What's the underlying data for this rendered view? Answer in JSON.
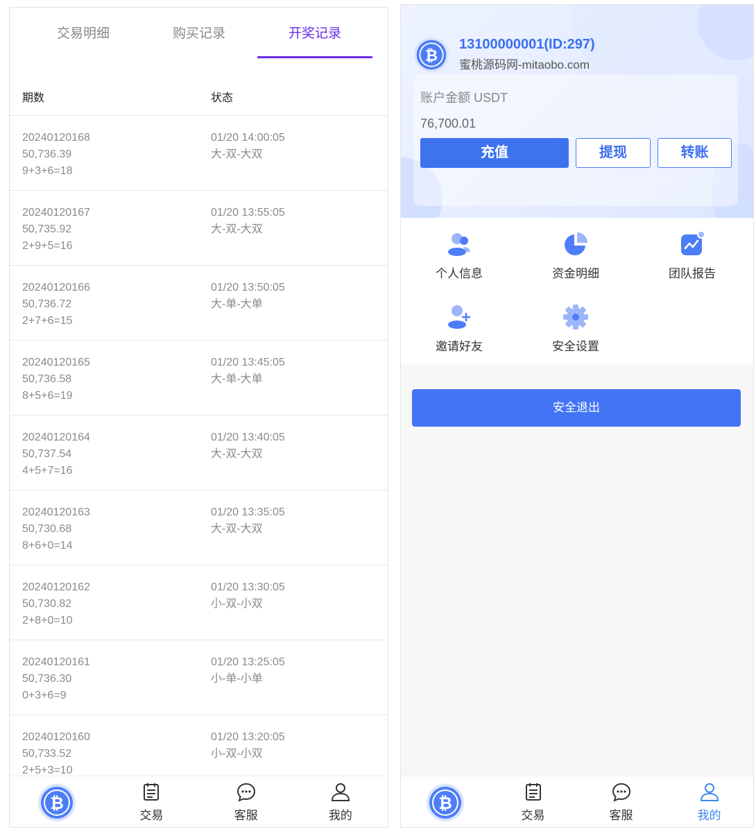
{
  "left": {
    "tabs": [
      {
        "label": "交易明细",
        "active": false
      },
      {
        "label": "购买记录",
        "active": false
      },
      {
        "label": "开奖记录",
        "active": true
      }
    ],
    "table_headers": {
      "period": "期数",
      "status": "状态"
    },
    "rows": [
      {
        "period": "20240120168",
        "price": "50,736.39",
        "formula": "9+3+6=18",
        "time": "01/20 14:00:05",
        "result": "大-双-大双"
      },
      {
        "period": "20240120167",
        "price": "50,735.92",
        "formula": "2+9+5=16",
        "time": "01/20 13:55:05",
        "result": "大-双-大双"
      },
      {
        "period": "20240120166",
        "price": "50,736.72",
        "formula": "2+7+6=15",
        "time": "01/20 13:50:05",
        "result": "大-单-大单"
      },
      {
        "period": "20240120165",
        "price": "50,736.58",
        "formula": "8+5+6=19",
        "time": "01/20 13:45:05",
        "result": "大-单-大单"
      },
      {
        "period": "20240120164",
        "price": "50,737.54",
        "formula": "4+5+7=16",
        "time": "01/20 13:40:05",
        "result": "大-双-大双"
      },
      {
        "period": "20240120163",
        "price": "50,730.68",
        "formula": "8+6+0=14",
        "time": "01/20 13:35:05",
        "result": "大-双-大双"
      },
      {
        "period": "20240120162",
        "price": "50,730.82",
        "formula": "2+8+0=10",
        "time": "01/20 13:30:05",
        "result": "小-双-小双"
      },
      {
        "period": "20240120161",
        "price": "50,736.30",
        "formula": "0+3+6=9",
        "time": "01/20 13:25:05",
        "result": "小-单-小单"
      },
      {
        "period": "20240120160",
        "price": "50,733.52",
        "formula": "2+5+3=10",
        "time": "01/20 13:20:05",
        "result": "小-双-小双"
      }
    ]
  },
  "nav": {
    "trade_label": "交易",
    "service_label": "客服",
    "mine_label": "我的"
  },
  "right": {
    "user_title": "13100000001(ID:297)",
    "user_site": "蜜桃源码网-mitaobo.com",
    "account_label": "账户金额 USDT",
    "account_value": "76,700.01",
    "btn_recharge": "充值",
    "btn_withdraw": "提现",
    "btn_transfer": "转账",
    "menu": [
      {
        "label": "个人信息",
        "icon": "user-group-icon"
      },
      {
        "label": "资金明细",
        "icon": "pie-chart-icon"
      },
      {
        "label": "团队报告",
        "icon": "trend-report-icon"
      },
      {
        "label": "邀请好友",
        "icon": "add-user-icon"
      },
      {
        "label": "安全设置",
        "icon": "gear-icon"
      }
    ],
    "logout_label": "安全退出"
  },
  "colors": {
    "accent_purple": "#6a2ee8",
    "primary_blue": "#3e73f0",
    "nav_active": "#3b86f0"
  }
}
